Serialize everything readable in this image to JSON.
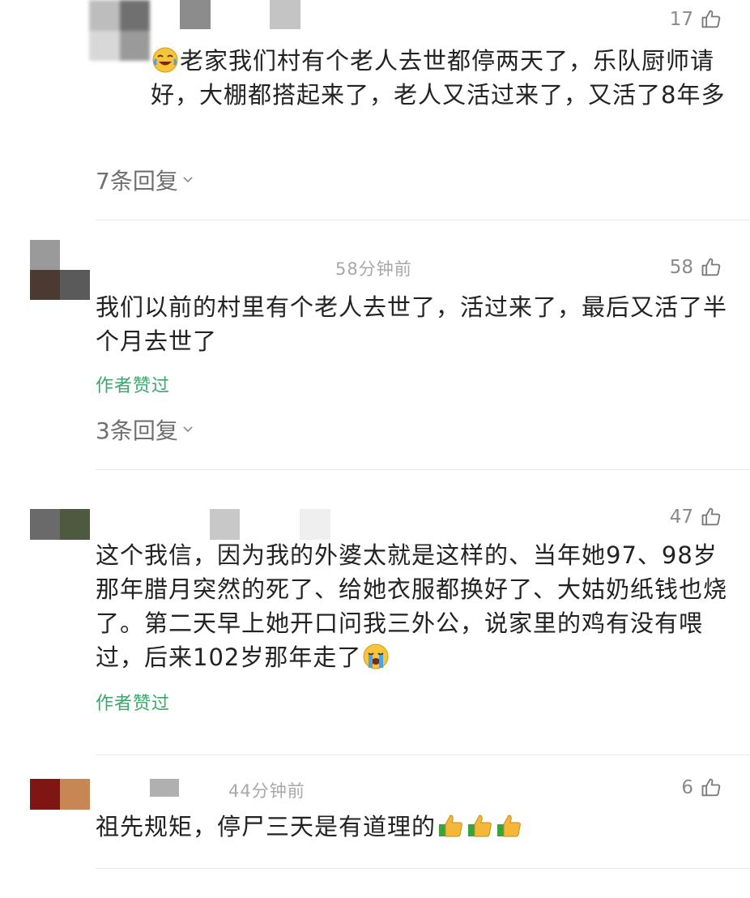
{
  "comments": [
    {
      "likes": "17",
      "text": "老家我们村有个老人去世都停两天了，乐队厨师请好，大棚都搭起来了，老人又活过来了，又活了8年多",
      "lead_emoji": "laughing-crying-face",
      "replies": "7条回复"
    },
    {
      "time": "58分钟前",
      "likes": "58",
      "text": "我们以前的村里有个老人去世了，活过来了，最后又活了半个月去世了",
      "author_liked": "作者赞过",
      "replies": "3条回复"
    },
    {
      "likes": "47",
      "text": "这个我信，因为我的外婆太就是这样的、当年她97、98岁那年腊月突然的死了、给她衣服都换好了、大姑奶纸钱也烧了。第二天早上她开口问我三外公，说家里的鸡有没有喂过，后来102岁那年走了",
      "trail_emoji": "loudly-crying-face",
      "author_liked": "作者赞过"
    },
    {
      "time": "44分钟前",
      "likes": "6",
      "text": "祖先规矩，停尸三天是有道理的",
      "trail_emoji": "thumbs-up x3"
    }
  ],
  "colors": {
    "text": "#222222",
    "meta": "#a8a8a8",
    "author_liked": "#3aa86a",
    "divider": "#e8e8e8"
  }
}
